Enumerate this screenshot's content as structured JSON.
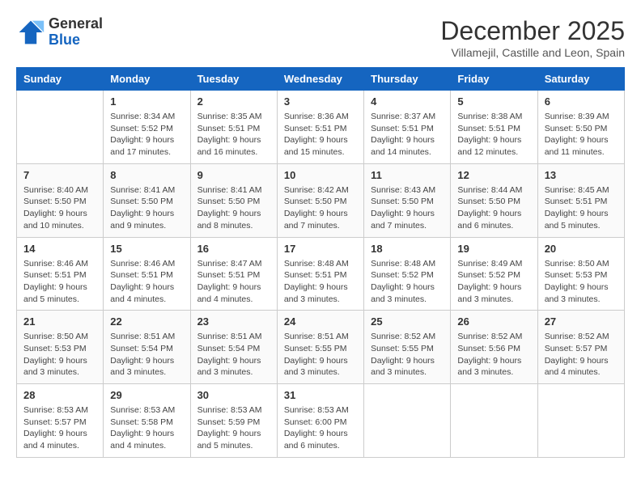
{
  "logo": {
    "general": "General",
    "blue": "Blue"
  },
  "header": {
    "month": "December 2025",
    "location": "Villamejil, Castille and Leon, Spain"
  },
  "weekdays": [
    "Sunday",
    "Monday",
    "Tuesday",
    "Wednesday",
    "Thursday",
    "Friday",
    "Saturday"
  ],
  "weeks": [
    [
      {
        "day": "",
        "info": ""
      },
      {
        "day": "1",
        "info": "Sunrise: 8:34 AM\nSunset: 5:52 PM\nDaylight: 9 hours\nand 17 minutes."
      },
      {
        "day": "2",
        "info": "Sunrise: 8:35 AM\nSunset: 5:51 PM\nDaylight: 9 hours\nand 16 minutes."
      },
      {
        "day": "3",
        "info": "Sunrise: 8:36 AM\nSunset: 5:51 PM\nDaylight: 9 hours\nand 15 minutes."
      },
      {
        "day": "4",
        "info": "Sunrise: 8:37 AM\nSunset: 5:51 PM\nDaylight: 9 hours\nand 14 minutes."
      },
      {
        "day": "5",
        "info": "Sunrise: 8:38 AM\nSunset: 5:51 PM\nDaylight: 9 hours\nand 12 minutes."
      },
      {
        "day": "6",
        "info": "Sunrise: 8:39 AM\nSunset: 5:50 PM\nDaylight: 9 hours\nand 11 minutes."
      }
    ],
    [
      {
        "day": "7",
        "info": "Sunrise: 8:40 AM\nSunset: 5:50 PM\nDaylight: 9 hours\nand 10 minutes."
      },
      {
        "day": "8",
        "info": "Sunrise: 8:41 AM\nSunset: 5:50 PM\nDaylight: 9 hours\nand 9 minutes."
      },
      {
        "day": "9",
        "info": "Sunrise: 8:41 AM\nSunset: 5:50 PM\nDaylight: 9 hours\nand 8 minutes."
      },
      {
        "day": "10",
        "info": "Sunrise: 8:42 AM\nSunset: 5:50 PM\nDaylight: 9 hours\nand 7 minutes."
      },
      {
        "day": "11",
        "info": "Sunrise: 8:43 AM\nSunset: 5:50 PM\nDaylight: 9 hours\nand 7 minutes."
      },
      {
        "day": "12",
        "info": "Sunrise: 8:44 AM\nSunset: 5:50 PM\nDaylight: 9 hours\nand 6 minutes."
      },
      {
        "day": "13",
        "info": "Sunrise: 8:45 AM\nSunset: 5:51 PM\nDaylight: 9 hours\nand 5 minutes."
      }
    ],
    [
      {
        "day": "14",
        "info": "Sunrise: 8:46 AM\nSunset: 5:51 PM\nDaylight: 9 hours\nand 5 minutes."
      },
      {
        "day": "15",
        "info": "Sunrise: 8:46 AM\nSunset: 5:51 PM\nDaylight: 9 hours\nand 4 minutes."
      },
      {
        "day": "16",
        "info": "Sunrise: 8:47 AM\nSunset: 5:51 PM\nDaylight: 9 hours\nand 4 minutes."
      },
      {
        "day": "17",
        "info": "Sunrise: 8:48 AM\nSunset: 5:51 PM\nDaylight: 9 hours\nand 3 minutes."
      },
      {
        "day": "18",
        "info": "Sunrise: 8:48 AM\nSunset: 5:52 PM\nDaylight: 9 hours\nand 3 minutes."
      },
      {
        "day": "19",
        "info": "Sunrise: 8:49 AM\nSunset: 5:52 PM\nDaylight: 9 hours\nand 3 minutes."
      },
      {
        "day": "20",
        "info": "Sunrise: 8:50 AM\nSunset: 5:53 PM\nDaylight: 9 hours\nand 3 minutes."
      }
    ],
    [
      {
        "day": "21",
        "info": "Sunrise: 8:50 AM\nSunset: 5:53 PM\nDaylight: 9 hours\nand 3 minutes."
      },
      {
        "day": "22",
        "info": "Sunrise: 8:51 AM\nSunset: 5:54 PM\nDaylight: 9 hours\nand 3 minutes."
      },
      {
        "day": "23",
        "info": "Sunrise: 8:51 AM\nSunset: 5:54 PM\nDaylight: 9 hours\nand 3 minutes."
      },
      {
        "day": "24",
        "info": "Sunrise: 8:51 AM\nSunset: 5:55 PM\nDaylight: 9 hours\nand 3 minutes."
      },
      {
        "day": "25",
        "info": "Sunrise: 8:52 AM\nSunset: 5:55 PM\nDaylight: 9 hours\nand 3 minutes."
      },
      {
        "day": "26",
        "info": "Sunrise: 8:52 AM\nSunset: 5:56 PM\nDaylight: 9 hours\nand 3 minutes."
      },
      {
        "day": "27",
        "info": "Sunrise: 8:52 AM\nSunset: 5:57 PM\nDaylight: 9 hours\nand 4 minutes."
      }
    ],
    [
      {
        "day": "28",
        "info": "Sunrise: 8:53 AM\nSunset: 5:57 PM\nDaylight: 9 hours\nand 4 minutes."
      },
      {
        "day": "29",
        "info": "Sunrise: 8:53 AM\nSunset: 5:58 PM\nDaylight: 9 hours\nand 4 minutes."
      },
      {
        "day": "30",
        "info": "Sunrise: 8:53 AM\nSunset: 5:59 PM\nDaylight: 9 hours\nand 5 minutes."
      },
      {
        "day": "31",
        "info": "Sunrise: 8:53 AM\nSunset: 6:00 PM\nDaylight: 9 hours\nand 6 minutes."
      },
      {
        "day": "",
        "info": ""
      },
      {
        "day": "",
        "info": ""
      },
      {
        "day": "",
        "info": ""
      }
    ]
  ]
}
